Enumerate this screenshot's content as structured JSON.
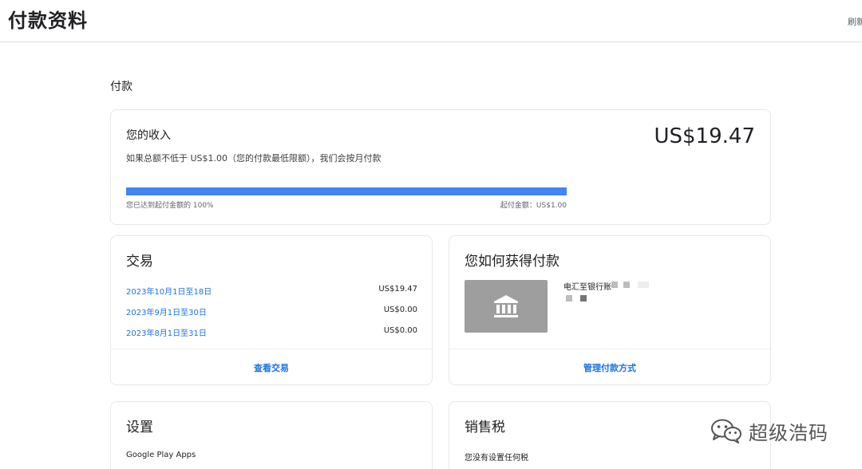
{
  "header": {
    "title": "付款资料",
    "refresh_label": "刷新"
  },
  "section": {
    "label": "付款"
  },
  "earnings": {
    "title": "您的收入",
    "amount": "US$19.47",
    "description": "如果总额不低于 US$1.00（您的付款最低限额），我们会按月付款",
    "progress_fraction": 1.0,
    "progress_left_label": "您已达到起付金额的 100%",
    "progress_right_label": "起付金额：US$1.00",
    "progress_color": "#4285f4"
  },
  "transactions": {
    "heading": "交易",
    "rows": [
      {
        "date": "2023年10月1日至18日",
        "amount": "US$19.47"
      },
      {
        "date": "2023年9月1日至30日",
        "amount": "US$0.00"
      },
      {
        "date": "2023年8月1日至31日",
        "amount": "US$0.00"
      }
    ],
    "action_label": "查看交易"
  },
  "payment_method": {
    "heading": "您如何获得付款",
    "icon": "bank-icon",
    "method_label": "电汇至银行账",
    "action_label": "管理付款方式"
  },
  "settings": {
    "heading": "设置",
    "item": "Google Play Apps"
  },
  "sales_tax": {
    "heading": "销售税",
    "item": "您没有设置任何税"
  },
  "watermark": {
    "text": "超级浩码",
    "icon": "wechat-icon"
  },
  "colors": {
    "accent": "#1a73e8",
    "progress": "#4285f4",
    "border": "#e8e8e8"
  }
}
